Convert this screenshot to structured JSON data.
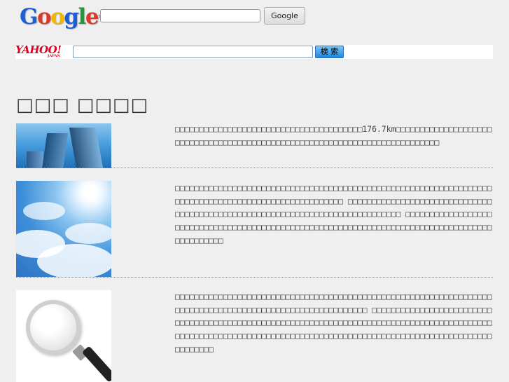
{
  "search": {
    "google": {
      "logo_text": "Google",
      "logo_tm": "TM",
      "input_value": "",
      "button_label": "Google"
    },
    "yahoo": {
      "logo_text": "YAHOO!",
      "logo_sub": "JAPAN",
      "input_value": "",
      "button_label": "検 索"
    }
  },
  "page": {
    "title": "□□□ □□□□"
  },
  "articles": [
    {
      "image": "buildings-image",
      "text": "□□□□□□□□□□□□□□□□□□□□□□□□□□□□□□□□□□□□□□□176.7km□□□□□□□□□□□□□□□□□□□□□□□□□□□□□□□□□□□□□□□□□□□□□□□□□□□□□□□□□□□□□□□□□□□□□□□□□□□"
    },
    {
      "image": "sky-clouds-image",
      "text": "□□□□□□□□□□□□□□□□□□□□□□□□□□□□□□□□□□□□□□□□□□□□□□□□□□□□□□□□□□□□□□□□□□□□□□□□□□□□□□□□□□□□□□□□□□□□□□□□□□□□□ □□□□□□□□□□□□□□□□□□□□□□□□□□□□□□□□□□□□□□□□□□□□□□□□□□□□□□□□□□□□□□□□□□□□□□□□□□□□□ □□□□□□□□□□□□□□□□□□□□□□□□□□□□□□□□□□□□□□□□□□□□□□□□□□□□□□□□□□□□□□□□□□□□□□□□□□□□□□□□□□□□□□□□□□□□□□"
    },
    {
      "image": "magnifying-glass-image",
      "text": "□□□□□□□□□□□□□□□□□□□□□□□□□□□□□□□□□□□□□□□□□□□□□□□□□□□□□□□□□□□□□□□□□□□□□□□□□□□□□□□□□□□□□□□□□□□□□□□□□□□□□□□□□□ □□□□□□□□□□□□□□□□□□□□□□□□□□□□□□□□□□□□□□□□□□□□□□□□□□□□□□□□□□□□□□□□□□□□□□□□□□□□□□□□□□□□□□□□□□□□□□□□□□□□□□□□□□□□□□□□□□□□□□□□□□□□□□□□□□□□□□□□□□□□□□□□□□□□□□□□□□□□□□□□□□□□□"
    }
  ],
  "colors": {
    "background": "#efefef",
    "text": "#444444",
    "title": "#333333",
    "yahoo_red": "#e0001f",
    "yahoo_button": "#1e88e0"
  }
}
